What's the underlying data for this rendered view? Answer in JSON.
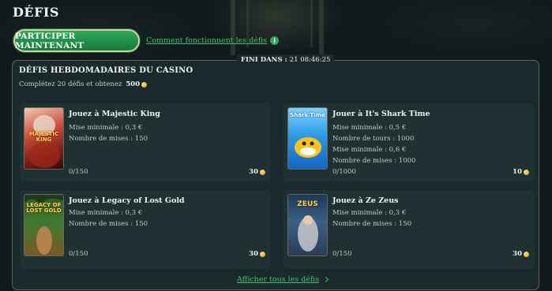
{
  "page": {
    "title": "DÉFIS"
  },
  "header": {
    "cta_label": "PARTICIPER MAINTENANT",
    "how_link": "Comment fonctionnent les défis",
    "info_icon": "i"
  },
  "panel": {
    "timer_label": "FINI DANS :",
    "timer_value": "21 08:46:25",
    "title": "DÉFIS HEBDOMADAIRES DU CASINO",
    "subtitle": "Complétez 20 défis et obtenez",
    "reward": "500",
    "show_all": "Afficher tous les défis"
  },
  "cards": [
    {
      "title": "Jouez à Majestic King",
      "lines": [
        "Mise minimale : 0,3 €",
        "Nombre de mises : 150"
      ],
      "progress": "0/150",
      "reward": "30",
      "thumb_text": "MAJESTIC KING",
      "thumb_icon": "lion-king-thumbnail"
    },
    {
      "title": "Jouer à It's Shark Time",
      "lines": [
        "Mise minimale : 0,5 €",
        "Nombre de tours : 1000",
        "Mise minimale : 0,6 €",
        "Nombre de mises : 1000"
      ],
      "progress": "0/1000",
      "reward": "10",
      "thumb_text": "Shark Time",
      "thumb_icon": "shark-thumbnail"
    },
    {
      "title": "Jouez à Legacy of Lost Gold",
      "lines": [
        "Mise minimale : 0,3 €",
        "Nombre de mises : 150"
      ],
      "progress": "0/150",
      "reward": "30",
      "thumb_text": "LEGACY OF LOST GOLD",
      "thumb_icon": "jungle-thumbnail"
    },
    {
      "title": "Jouez à Ze Zeus",
      "lines": [
        "Mise minimale : 0,3 €",
        "Nombre de mises : 150"
      ],
      "progress": "0/150",
      "reward": "30",
      "thumb_text": "ZEUS",
      "thumb_icon": "zeus-thumbnail"
    }
  ],
  "colors": {
    "accent_green": "#2fa356",
    "panel_bg": "#1a2a2c",
    "card_bg": "#203134",
    "coin_gold": "#e0a82a"
  }
}
